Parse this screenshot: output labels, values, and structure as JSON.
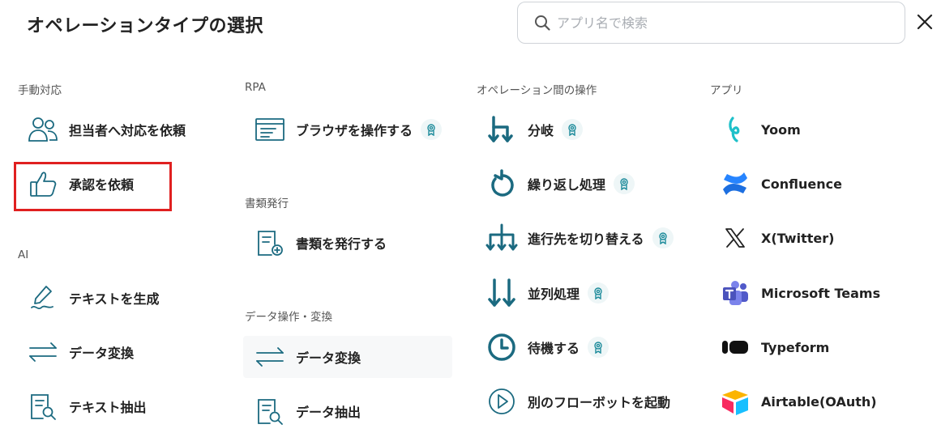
{
  "title": "オペレーションタイプの選択",
  "search": {
    "placeholder": "アプリ名で検索",
    "value": ""
  },
  "colors": {
    "accent": "#1b6a80",
    "highlight": "#e02020",
    "badge_bg": "#eef6f7"
  },
  "columns": {
    "manual": {
      "section": "手動対応",
      "items": [
        {
          "label": "担当者へ対応を依頼",
          "icon": "users-icon"
        },
        {
          "label": "承認を依頼",
          "icon": "thumbs-up-icon"
        }
      ]
    },
    "ai": {
      "section": "AI",
      "items": [
        {
          "label": "テキストを生成",
          "icon": "pen-icon"
        },
        {
          "label": "データ変換",
          "icon": "arrows-exchange-icon"
        },
        {
          "label": "テキスト抽出",
          "icon": "document-search-icon"
        }
      ]
    },
    "rpa": {
      "section": "RPA",
      "items": [
        {
          "label": "ブラウザを操作する",
          "icon": "browser-icon"
        }
      ]
    },
    "docs": {
      "section": "書類発行",
      "items": [
        {
          "label": "書類を発行する",
          "icon": "document-add-icon"
        }
      ]
    },
    "data": {
      "section": "データ操作・変換",
      "items": [
        {
          "label": "データ変換",
          "icon": "arrows-exchange-icon"
        },
        {
          "label": "データ抽出",
          "icon": "document-search-icon"
        }
      ]
    },
    "ops": {
      "section": "オペレーション間の操作",
      "items": [
        {
          "label": "分岐",
          "icon": "branch-icon"
        },
        {
          "label": "繰り返し処理",
          "icon": "loop-icon"
        },
        {
          "label": "進行先を切り替える",
          "icon": "switch-route-icon"
        },
        {
          "label": "並列処理",
          "icon": "parallel-icon"
        },
        {
          "label": "待機する",
          "icon": "clock-icon"
        },
        {
          "label": "別のフローボットを起動",
          "icon": "play-circle-icon"
        }
      ]
    },
    "apps": {
      "section": "アプリ",
      "items": [
        {
          "label": "Yoom",
          "icon": "yoom-logo-icon"
        },
        {
          "label": "Confluence",
          "icon": "confluence-logo-icon"
        },
        {
          "label": "X(Twitter)",
          "icon": "x-logo-icon"
        },
        {
          "label": "Microsoft Teams",
          "icon": "teams-logo-icon"
        },
        {
          "label": "Typeform",
          "icon": "typeform-logo-icon"
        },
        {
          "label": "Airtable(OAuth)",
          "icon": "airtable-logo-icon"
        }
      ]
    }
  }
}
